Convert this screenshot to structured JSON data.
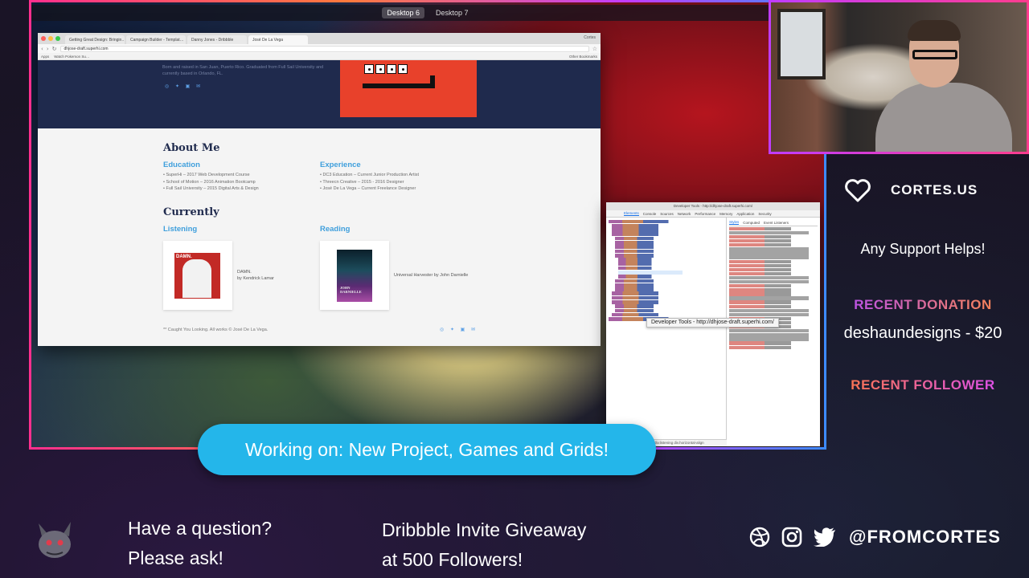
{
  "desktop": {
    "spaces": [
      "Desktop 6",
      "Desktop 7"
    ],
    "active_space": "Desktop 6"
  },
  "browser": {
    "tabs": [
      "Getting Great Design: Bringin…",
      "Campaign Builder - Templat…",
      "Danny Jones - Dribbble",
      "José De La Vega"
    ],
    "user": "Cortes",
    "url": "dhjose-draft.superhi.com",
    "bookmarks": [
      "Apps",
      "Watch Pokemon Su…"
    ],
    "other_bookmarks": "Other Bookmarks"
  },
  "site": {
    "bio": "Born and raised in San Juan, Puerto Rico. Graduated from Full Sail University and currently based in Orlando, FL.",
    "about_heading": "About Me",
    "education_heading": "Education",
    "education": [
      "• SuperHi – 2017 Web Development Course",
      "• School of Motion – 2016 Animation Bootcamp",
      "• Full Sail University – 2015 Digital Arts & Design"
    ],
    "experience_heading": "Experience",
    "experience": [
      "• DC3 Education – Current Junior Production Artist",
      "• Threecn Creative – 2015 - 2016 Designer",
      "• José De La Vega – Current Freelance Designer"
    ],
    "currently_heading": "Currently",
    "listening_heading": "Listening",
    "listening_title": "DAMN.",
    "listening_artist": "by Kendrick Lamar",
    "listening_cover_text": "DAMN.",
    "reading_heading": "Reading",
    "reading_title": "Universal Harvester by John Darnielle",
    "reading_cover_text": "JOHN DARNIELLE",
    "footer": "** Caught You Looking. All works © José De La Vega."
  },
  "devtools": {
    "title": "Developer Tools - http://dhjose-draft.superhi.com/",
    "tabs": [
      "Elements",
      "Console",
      "Sources",
      "Network",
      "Performance",
      "Memory",
      "Application",
      "Security"
    ],
    "style_tabs": [
      "Styles",
      "Computed",
      "Event Listeners"
    ],
    "tooltip": "Developer Tools - http://dhjose-draft.superhi.com/",
    "crumbs": "div.listening   div.horizontal-align"
  },
  "sidebar": {
    "brand": "CORTES.US",
    "support": "Any Support Helps!",
    "recent_donation_label": "RECENT DONATION",
    "recent_donation": "deshaundesigns - $20",
    "recent_follower_label": "RECENT FOLLOWER"
  },
  "overlay": {
    "working_on": "Working on: New Project, Games and Grids!",
    "question_line1": "Have a question?",
    "question_line2": "Please ask!",
    "giveaway_line1": "Dribbble Invite Giveaway",
    "giveaway_line2": "at 500 Followers!",
    "handle": "@FROMCORTES"
  },
  "colors": {
    "hero_navy": "#1f2a4d",
    "accent_blue": "#3f9fdc",
    "hero_art_red": "#e8412b",
    "working_pill": "#24b6ea"
  },
  "icons": [
    "heart-icon",
    "dribbble-icon",
    "instagram-icon",
    "twitter-icon",
    "email-icon"
  ]
}
